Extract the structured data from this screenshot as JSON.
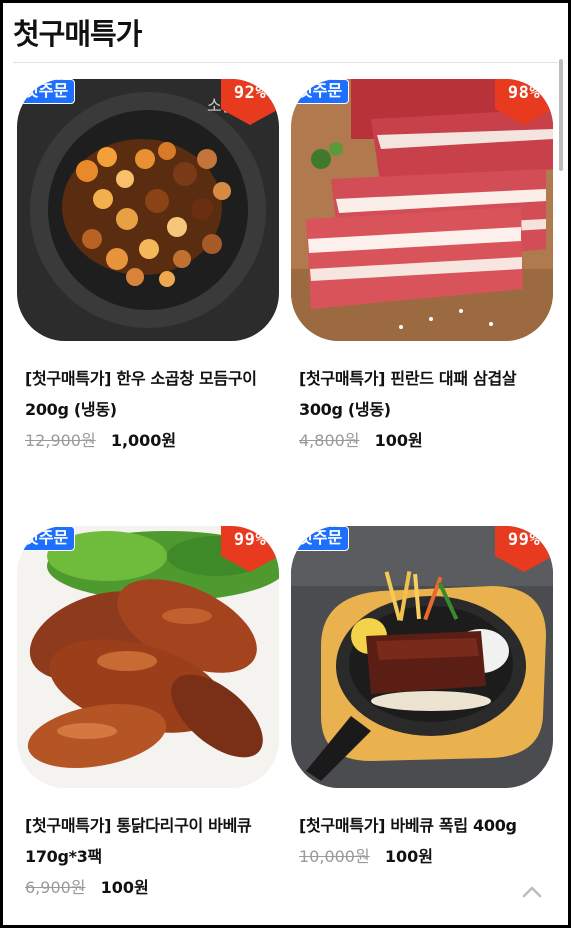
{
  "header": {
    "title": "첫구매특가"
  },
  "products": [
    {
      "badge": "첫주문",
      "discount": "92%",
      "title": "[첫구매특가] 한우 소곱창 모듬구이 200g (냉동)",
      "original_price": "12,900원",
      "sale_price": "1,000원",
      "image_icon": "grilled-tripe-image"
    },
    {
      "badge": "첫주문",
      "discount": "98%",
      "title": "[첫구매특가] 핀란드 대패 삼겹살 300g (냉동)",
      "original_price": "4,800원",
      "sale_price": "100원",
      "image_icon": "pork-belly-image"
    },
    {
      "badge": "첫주문",
      "discount": "99%",
      "title": "[첫구매특가] 통닭다리구이 바베큐170g*3팩",
      "original_price": "6,900원",
      "sale_price": "100원",
      "image_icon": "bbq-chicken-legs-image"
    },
    {
      "badge": "첫주문",
      "discount": "99%",
      "title": "[첫구매특가] 바베큐 폭립 400g",
      "original_price": "10,000원",
      "sale_price": "100원",
      "image_icon": "bbq-pork-ribs-image"
    }
  ],
  "colors": {
    "badge_blue": "#1f6fff",
    "discount_red": "#e83a1e",
    "strike_gray": "#9a9a9a"
  }
}
